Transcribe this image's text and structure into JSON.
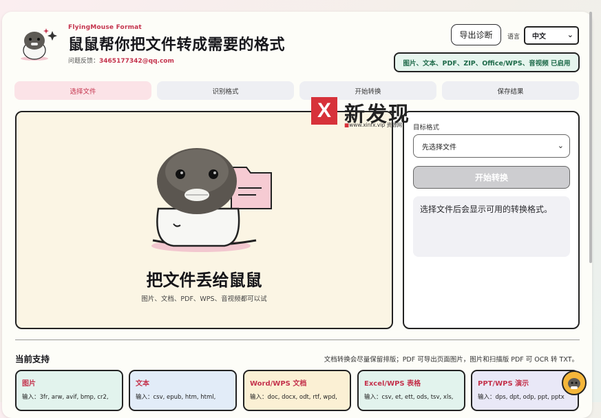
{
  "header": {
    "brand": "FlyingMouse Format",
    "title": "鼠鼠帮你把文件转成需要的格式",
    "feedback_label": "问题反馈：",
    "feedback_email": "3465177342@qq.com",
    "export_label": "导出诊断",
    "lang_label": "语言",
    "lang_value": "中文",
    "enabled_badge": "图片、文本、PDF、ZIP、Office/WPS、音视频 已启用"
  },
  "steps": [
    {
      "label": "选择文件",
      "active": true
    },
    {
      "label": "识别格式",
      "active": false
    },
    {
      "label": "开始转换",
      "active": false
    },
    {
      "label": "保存结果",
      "active": false
    }
  ],
  "dropzone": {
    "title": "把文件丢给鼠鼠",
    "subtitle": "图片、文档、PDF、WPS、音视频都可以试"
  },
  "panel": {
    "target_label": "目标格式",
    "select_placeholder": "先选择文件",
    "convert_label": "开始转换",
    "hint": "选择文件后会显示可用的转换格式。"
  },
  "watermark": {
    "mark": "X",
    "text": "新发现",
    "url_dot": "■",
    "url": "www.xinfx.vip",
    "url_suffix": "资源网"
  },
  "support": {
    "title": "当前支持",
    "note": "文档转换会尽量保留排版；PDF 可导出页面图片，图片和扫描版 PDF 可 OCR 转 TXT。",
    "cards": [
      {
        "name": "图片",
        "inputs": "输入：3fr, arw, avif, bmp, cr2,"
      },
      {
        "name": "文本",
        "inputs": "输入：csv, epub, htm, html,"
      },
      {
        "name": "Word/WPS 文档",
        "inputs": "输入：doc, docx, odt, rtf, wpd,"
      },
      {
        "name": "Excel/WPS 表格",
        "inputs": "输入：csv, et, ett, ods, tsv, xls,"
      },
      {
        "name": "PPT/WPS 演示",
        "inputs": "输入：dps, dpt, odp, ppt, pptx"
      }
    ]
  },
  "colors": {
    "accent": "#c4324c",
    "success_text": "#1f6b4a",
    "success_bg": "#e6f5ee"
  }
}
